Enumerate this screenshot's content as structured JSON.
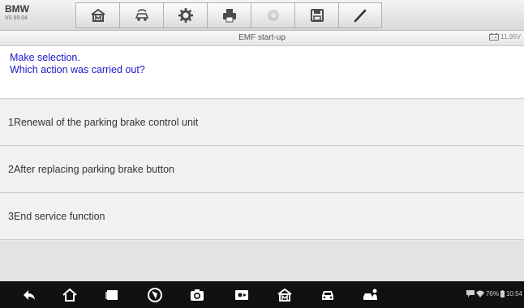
{
  "header": {
    "brand": "BMW",
    "version": "V0.99.04",
    "tools": [
      {
        "icon": "home-icon",
        "enabled": true
      },
      {
        "icon": "vehicle-swap-icon",
        "enabled": true
      },
      {
        "icon": "settings-gear-icon",
        "enabled": true
      },
      {
        "icon": "print-icon",
        "enabled": true
      },
      {
        "icon": "help-icon",
        "enabled": false
      },
      {
        "icon": "save-icon",
        "enabled": true
      },
      {
        "icon": "pen-icon",
        "enabled": true
      }
    ]
  },
  "infobar": {
    "title": "EMF start-up",
    "voltage": "11.95V"
  },
  "prompt": {
    "line1": "Make selection.",
    "line2": "Which action was carried out?"
  },
  "options": [
    "1Renewal of the parking brake control unit",
    "2After replacing parking brake button",
    "3End service function"
  ],
  "navbar": {
    "icons": [
      "back-icon",
      "home-icon",
      "recent-apps-icon",
      "browser-icon",
      "camera-icon",
      "screen-capture-icon",
      "maxisys-home-icon",
      "vehicle-icon",
      "service-icon"
    ],
    "battery": "76%",
    "time": "10:54"
  },
  "colors": {
    "prompt_text": "#1a1acc",
    "navbar_bg": "#111111"
  }
}
